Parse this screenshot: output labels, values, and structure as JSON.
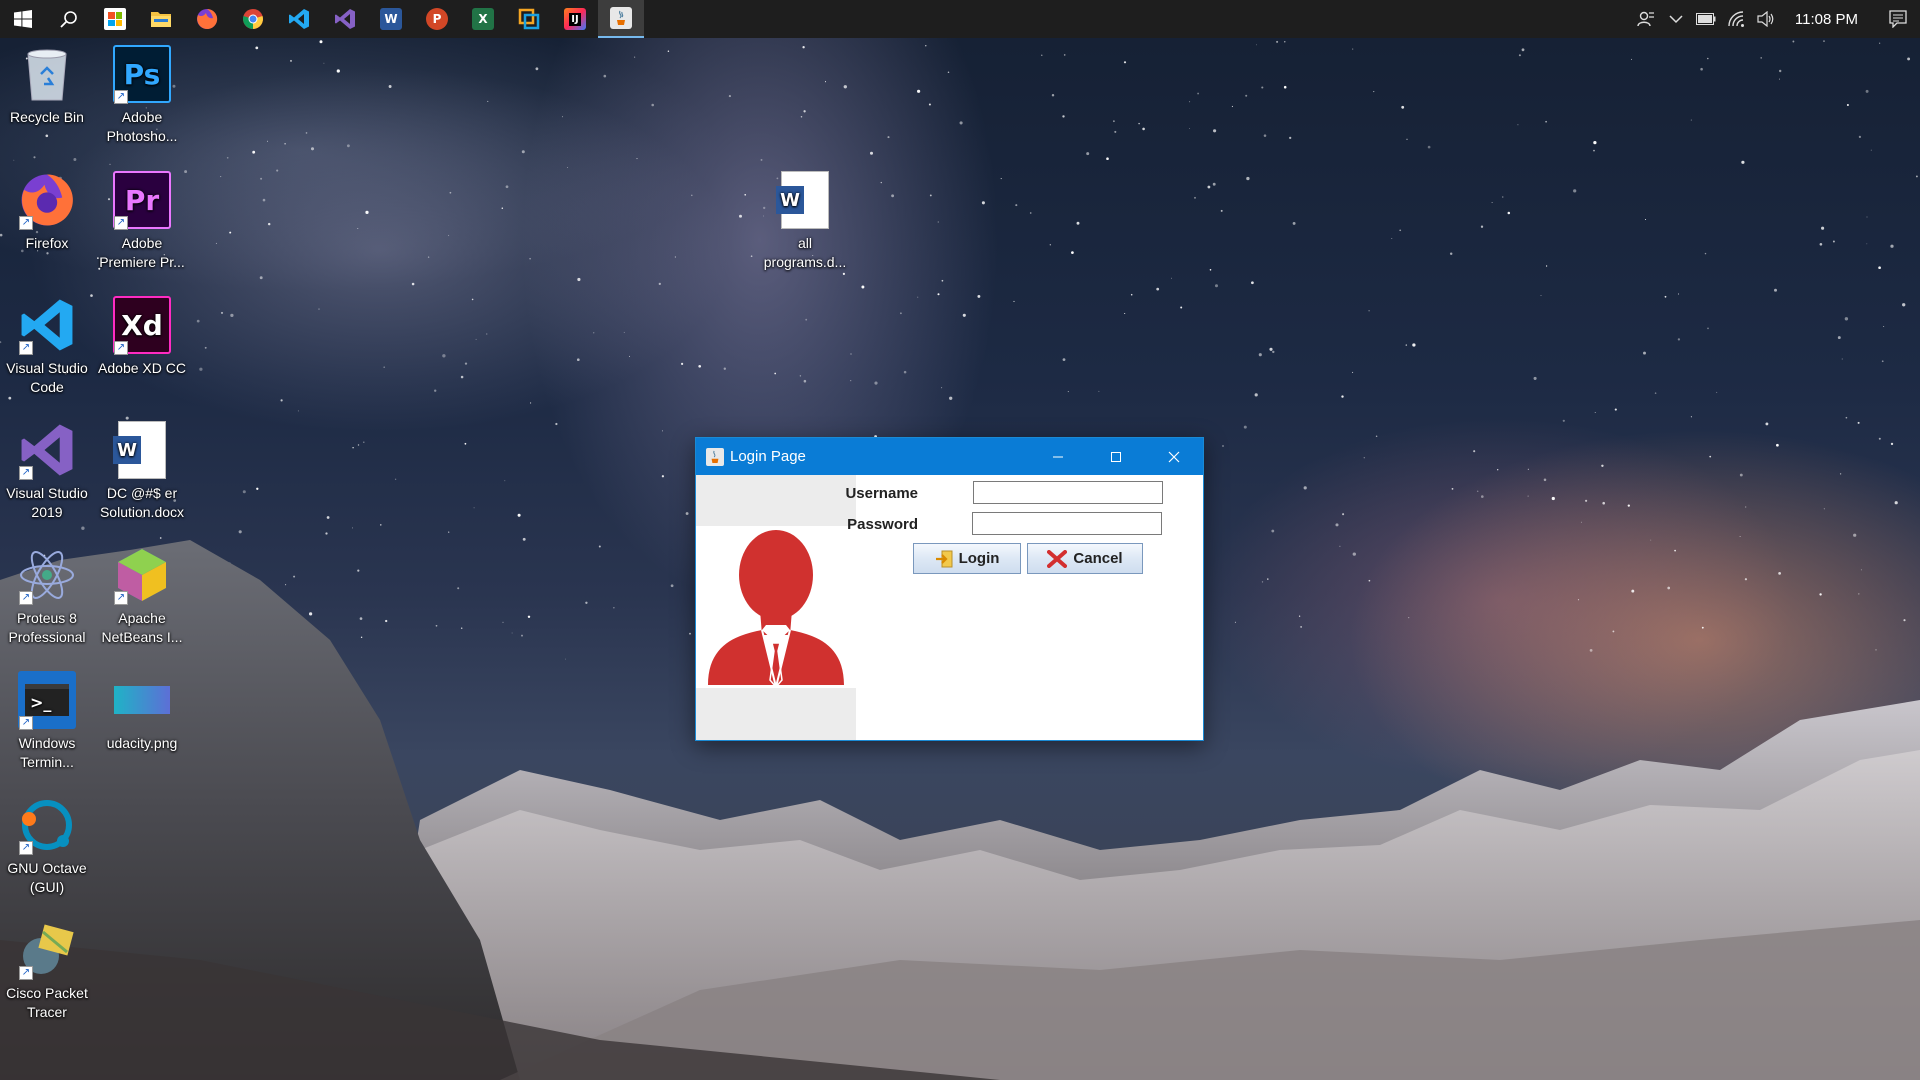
{
  "taskbar": {
    "apps": [
      {
        "name": "start",
        "icon": "windows-logo-icon"
      },
      {
        "name": "search",
        "icon": "search-icon"
      },
      {
        "name": "store",
        "icon": "store-icon"
      },
      {
        "name": "file-explorer",
        "icon": "folder-icon"
      },
      {
        "name": "firefox",
        "icon": "firefox-icon"
      },
      {
        "name": "chrome",
        "icon": "chrome-icon"
      },
      {
        "name": "vscode",
        "icon": "vscode-icon"
      },
      {
        "name": "visual-studio",
        "icon": "visual-studio-icon"
      },
      {
        "name": "word",
        "icon": "word-icon",
        "letter": "W"
      },
      {
        "name": "powerpoint",
        "icon": "powerpoint-icon",
        "letter": "P"
      },
      {
        "name": "excel",
        "icon": "excel-icon",
        "letter": "X"
      },
      {
        "name": "app-orange",
        "icon": "app-icon"
      },
      {
        "name": "intellij",
        "icon": "intellij-icon",
        "letter": "IJ"
      },
      {
        "name": "java-app",
        "icon": "java-icon"
      }
    ],
    "clock": "11:08 PM"
  },
  "desktop": {
    "icons": [
      {
        "id": "recycle-bin",
        "label": "Recycle Bin"
      },
      {
        "id": "photoshop",
        "label": "Adobe Photosho...",
        "letters": "Ps"
      },
      {
        "id": "firefox",
        "label": "Firefox"
      },
      {
        "id": "premiere",
        "label": "Adobe Premiere Pr...",
        "letters": "Pr"
      },
      {
        "id": "vscode",
        "label": "Visual Studio Code"
      },
      {
        "id": "xd",
        "label": "Adobe XD CC",
        "letters": "Xd"
      },
      {
        "id": "vs2019",
        "label": "Visual Studio 2019"
      },
      {
        "id": "docx",
        "label": "DC @#$ er Solution.docx",
        "letters": "W"
      },
      {
        "id": "proteus",
        "label": "Proteus 8 Professional"
      },
      {
        "id": "netbeans",
        "label": "Apache NetBeans I..."
      },
      {
        "id": "terminal",
        "label": "Windows Termin..."
      },
      {
        "id": "udacity",
        "label": "udacity.png"
      },
      {
        "id": "octave",
        "label": "GNU Octave (GUI)"
      },
      {
        "id": "packet-tracer",
        "label": "Cisco Packet Tracer"
      },
      {
        "id": "all-programs",
        "label": "all programs.d...",
        "letters": "W"
      }
    ]
  },
  "login_window": {
    "title": "Login Page",
    "username_label": "Username",
    "password_label": "Password",
    "username_value": "",
    "password_value": "",
    "login_label": "Login",
    "cancel_label": "Cancel"
  },
  "colors": {
    "titlebar": "#0a7cd6",
    "avatar": "#d0312f",
    "taskbar": "#1e1e1e"
  }
}
